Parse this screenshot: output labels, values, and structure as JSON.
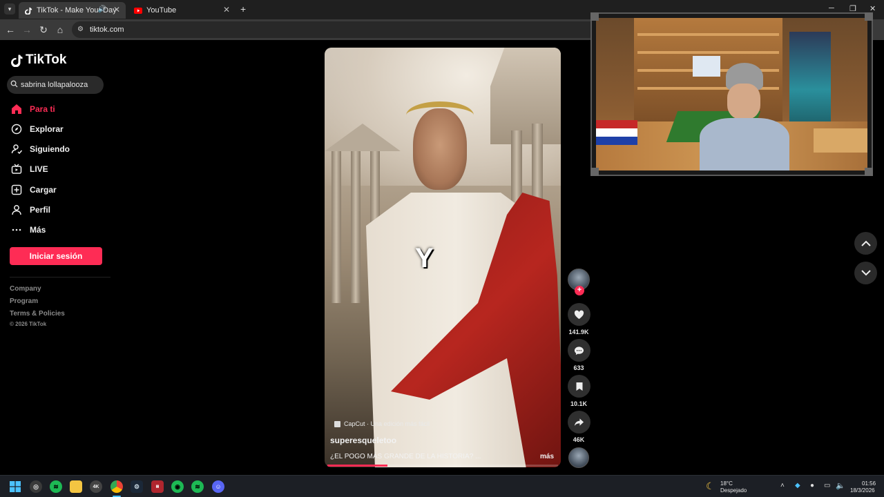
{
  "browser": {
    "tabs": [
      {
        "title": "TikTok - Make Your Day",
        "active": true,
        "audio_playing": true
      },
      {
        "title": "YouTube",
        "active": false
      }
    ],
    "new_tab_label": "+",
    "url": "tiktok.com"
  },
  "tiktok": {
    "logo_text": "TikTok",
    "search_value": "sabrina lollapalooza",
    "nav": [
      {
        "label": "Para ti",
        "icon": "home-icon",
        "active": true
      },
      {
        "label": "Explorar",
        "icon": "compass-icon"
      },
      {
        "label": "Siguiendo",
        "icon": "following-icon"
      },
      {
        "label": "LIVE",
        "icon": "live-icon"
      },
      {
        "label": "Cargar",
        "icon": "upload-icon"
      },
      {
        "label": "Perfil",
        "icon": "profile-icon"
      },
      {
        "label": "Más",
        "icon": "more-icon"
      }
    ],
    "login_label": "Iniciar sesión",
    "footer": {
      "links": [
        "Company",
        "Program",
        "Terms & Policies"
      ],
      "copyright": "© 2026 TikTok"
    },
    "accent_color": "#fe2c55"
  },
  "video": {
    "caption_overlay": "Y",
    "capcut_label": "CapCut · Una edición más fácil",
    "author": "superesqueletoo",
    "description": "¿EL POGO MÁS GRANDE DE LA HISTORIA? ...",
    "more_label": "más",
    "progress": 0.26,
    "actions": {
      "likes": "141.9K",
      "comments": "633",
      "saves": "10.1K",
      "shares": "46K"
    }
  },
  "taskbar": {
    "weather_temp": "18°C",
    "weather_desc": "Despejado",
    "time": "01:56",
    "date": "18/3/2026"
  }
}
